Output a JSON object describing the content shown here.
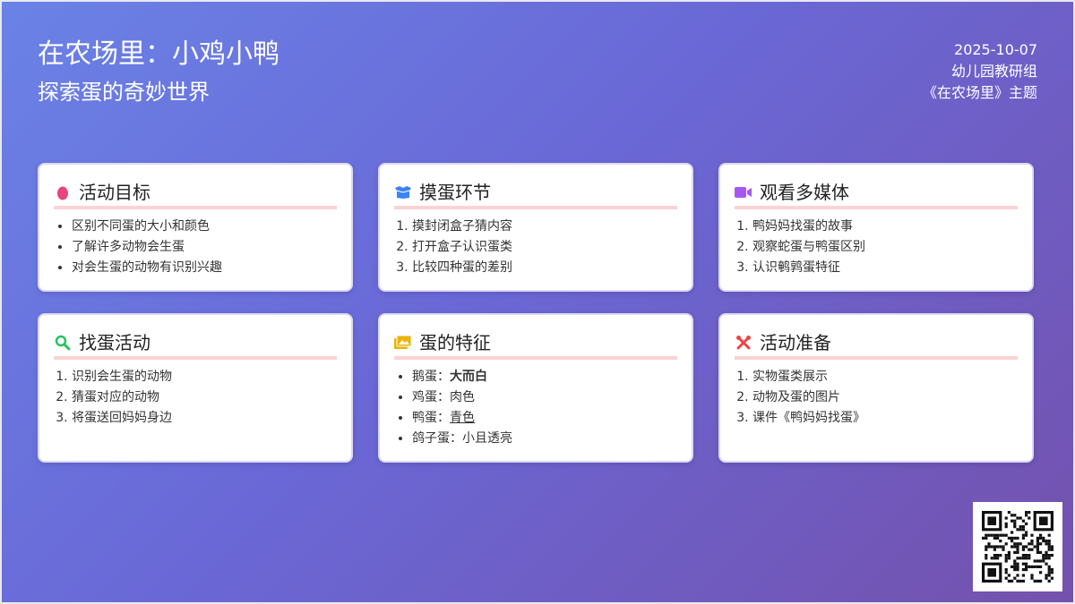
{
  "header": {
    "title": "在农场里：小鸡小鸭",
    "subtitle": "探索蛋的奇妙世界",
    "date": "2025-10-07",
    "org": "幼儿园教研组",
    "theme": "《在农场里》主题"
  },
  "cards": [
    {
      "icon": "egg-icon",
      "title": "活动目标",
      "list_type": "bullet",
      "items": [
        "区别不同蛋的大小和颜色",
        "了解许多动物会生蛋",
        "对会生蛋的动物有识别兴趣"
      ]
    },
    {
      "icon": "box-icon",
      "title": "摸蛋环节",
      "list_type": "numbered",
      "items": [
        "摸封闭盒子猜内容",
        "打开盒子认识蛋类",
        "比较四种蛋的差别"
      ]
    },
    {
      "icon": "video-icon",
      "title": "观看多媒体",
      "list_type": "numbered",
      "items": [
        "鸭妈妈找蛋的故事",
        "观察蛇蛋与鸭蛋区别",
        "认识鹌鹑蛋特征"
      ]
    },
    {
      "icon": "search-icon",
      "title": "找蛋活动",
      "list_type": "numbered",
      "items": [
        "识别会生蛋的动物",
        "猜蛋对应的动物",
        "将蛋送回妈妈身边"
      ]
    },
    {
      "icon": "image-icon",
      "title": "蛋的特征",
      "list_type": "bullet",
      "items": [
        {
          "label": "鹅蛋：",
          "value": "大而白",
          "style": "bold"
        },
        {
          "label": "鸡蛋：",
          "value": "肉色",
          "style": "plain"
        },
        {
          "label": "鸭蛋：",
          "value": "青色",
          "style": "underline"
        },
        {
          "label": "鸽子蛋：",
          "value": "小且透亮",
          "style": "plain"
        }
      ]
    },
    {
      "icon": "tools-icon",
      "title": "活动准备",
      "list_type": "numbered",
      "items": [
        "实物蛋类展示",
        "动物及蛋的图片",
        "课件《鸭妈妈找蛋》"
      ]
    }
  ],
  "colors": {
    "gradient_start": "#6a82e6",
    "gradient_end": "#7451ad",
    "underline": "#fbd3d3",
    "egg_icon": "#e8457a",
    "box_icon": "#3b82f6",
    "video_icon": "#a855f7",
    "search_icon": "#22c55e",
    "image_icon": "#eab308",
    "tools_icon": "#ef4444"
  },
  "qr_code": {
    "icon": "qr-code-icon"
  }
}
